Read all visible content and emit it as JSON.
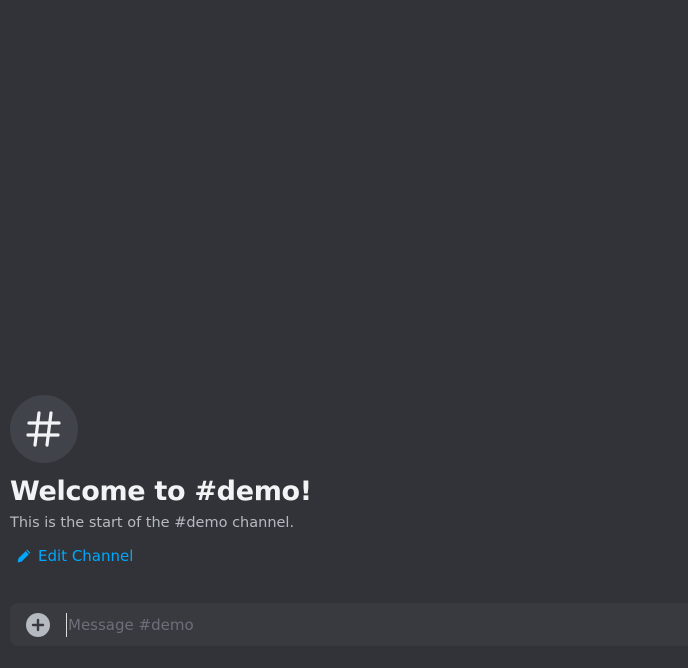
{
  "channel": {
    "name": "demo",
    "icon": "hashtag-icon"
  },
  "welcome": {
    "title": "Welcome to #demo!",
    "subtitle": "This is the start of the #demo channel.",
    "edit_label": "Edit Channel",
    "edit_icon": "pencil-icon"
  },
  "composer": {
    "placeholder": "Message #demo",
    "value": "",
    "attach_icon": "plus-circle-icon"
  },
  "colors": {
    "background": "#313338",
    "composer": "#383a40",
    "avatar": "#41434a",
    "link": "#00a8fc",
    "title": "#f2f3f5",
    "muted": "#b5bac1"
  }
}
